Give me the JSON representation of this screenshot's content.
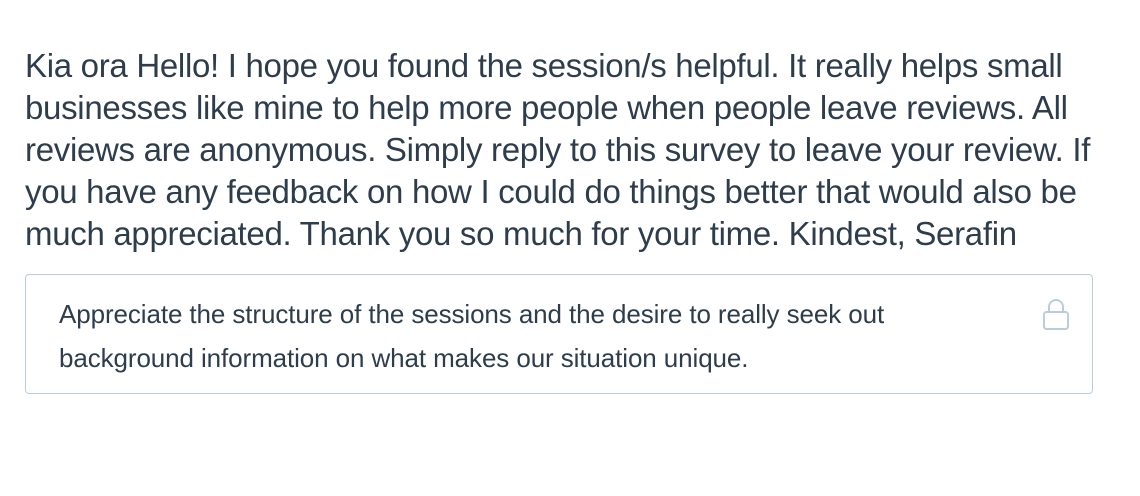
{
  "question": {
    "text": "Kia ora Hello! I hope you found the session/s helpful. It really helps small businesses like mine to help more people when people leave reviews. All reviews are anonymous. Simply reply to this survey to leave your review. If you have any feedback on how I could do things better that would also be much appreciated. Thank you so much for your time. Kindest, Serafin"
  },
  "response": {
    "value": "Appreciate the structure of the sessions and the desire to really seek out background information on what makes our situation unique.",
    "status_icon": "lock-icon"
  },
  "colors": {
    "text": "#2e3d4c",
    "border": "#b9cddd",
    "icon": "#b9cddd",
    "background": "#ffffff"
  }
}
